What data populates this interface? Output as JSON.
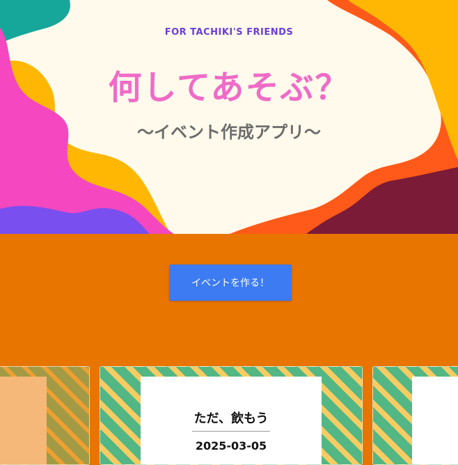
{
  "hero": {
    "subtitle": "FOR TACHIKI'S FRIENDS",
    "title": "何してあそぶ？",
    "tagline": "〜イベント作成アプリ〜"
  },
  "actions": {
    "create_event_label": "イベントを作る！"
  },
  "events": [
    {
      "title": "ただ、飲もう",
      "date": "2025-03-05"
    }
  ],
  "colors": {
    "page_background": "#e87500",
    "hero_background": "#fffaeb",
    "title": "#f06bc8",
    "subtitle": "#6a3fd6",
    "button": "#3d7bf2"
  }
}
